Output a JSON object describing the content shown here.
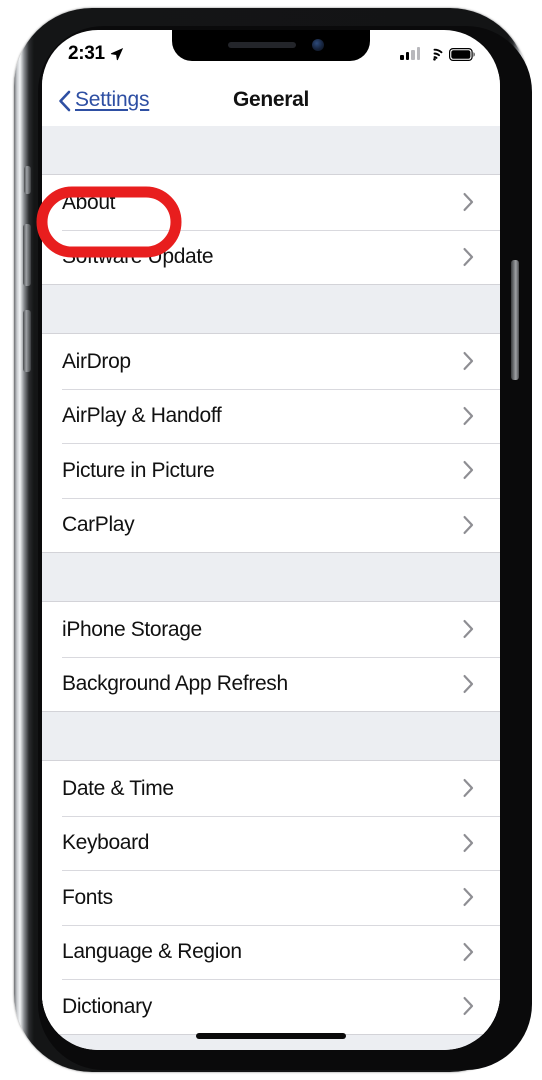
{
  "device": {
    "name": "iphone-x",
    "frame_color": "#2a2c2e",
    "screen_bg": "#ffffff"
  },
  "status_bar": {
    "time": "2:31",
    "location_icon": "location-arrow-icon",
    "cellular_icon": "cellular-signal-icon",
    "cellular_bars_filled": 2,
    "cellular_bars_total": 4,
    "wifi_icon": "wifi-icon",
    "battery_icon": "battery-full-icon",
    "battery_level_percent": 100
  },
  "nav_bar": {
    "back_icon": "chevron-left-icon",
    "back_label": "Settings",
    "back_color": "#2e4fa3",
    "title": "General"
  },
  "list": {
    "chevron_icon": "chevron-right-icon",
    "chevron_color": "#8e8e93",
    "background": "#eceef2",
    "row_background": "#ffffff",
    "sections": [
      {
        "name": "section-device-info",
        "rows": [
          {
            "label": "About"
          },
          {
            "label": "Software Update"
          }
        ]
      },
      {
        "name": "section-connectivity",
        "rows": [
          {
            "label": "AirDrop"
          },
          {
            "label": "AirPlay & Handoff"
          },
          {
            "label": "Picture in Picture"
          },
          {
            "label": "CarPlay"
          }
        ]
      },
      {
        "name": "section-storage",
        "rows": [
          {
            "label": "iPhone Storage"
          },
          {
            "label": "Background App Refresh"
          }
        ]
      },
      {
        "name": "section-localization",
        "rows": [
          {
            "label": "Date & Time"
          },
          {
            "label": "Keyboard"
          },
          {
            "label": "Fonts"
          },
          {
            "label": "Language & Region"
          },
          {
            "label": "Dictionary"
          }
        ]
      }
    ]
  },
  "annotation": {
    "type": "highlight-ellipse",
    "target": "About",
    "color": "#e81e1e",
    "stroke_width": 10
  },
  "home_indicator": {
    "icon": "home-indicator-bar"
  }
}
